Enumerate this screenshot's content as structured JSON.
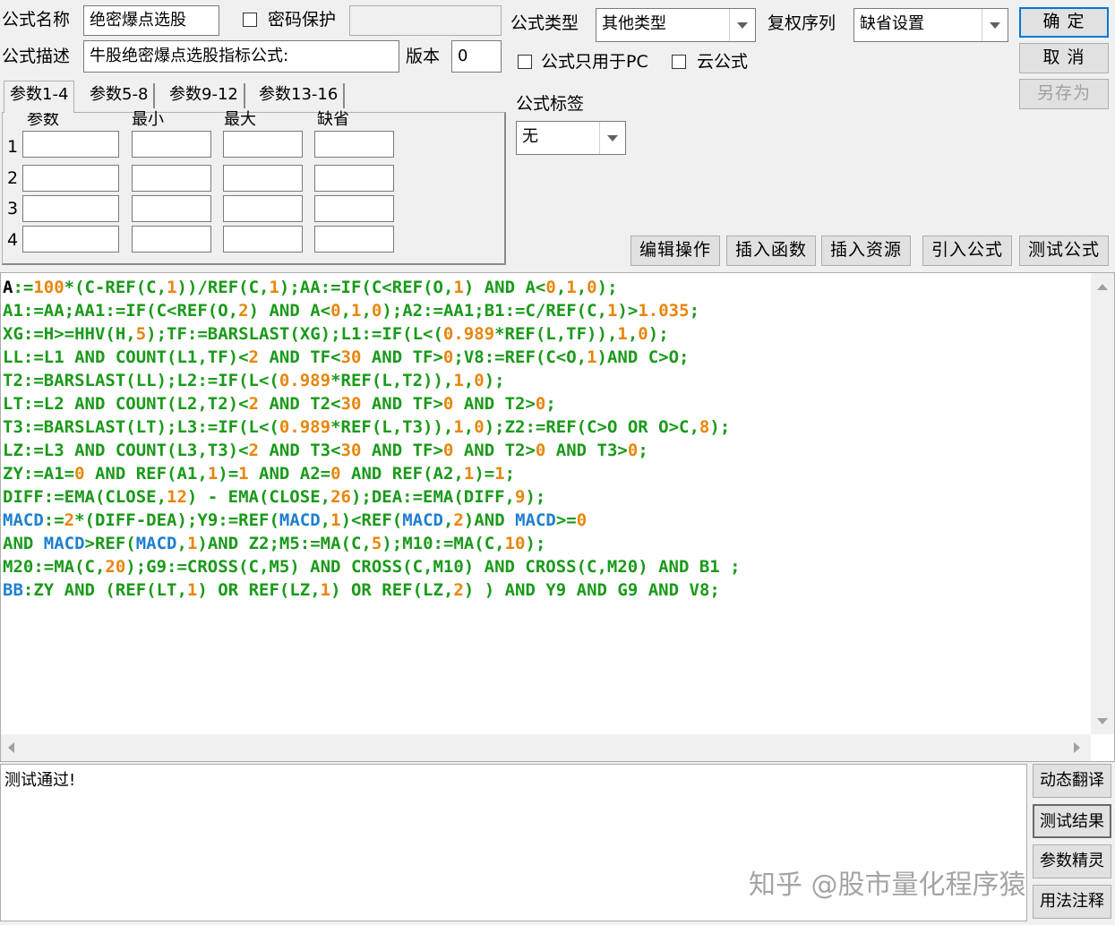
{
  "header": {
    "name_label": "公式名称",
    "name_value": "绝密爆点选股",
    "password_label": "密码保护",
    "desc_label": "公式描述",
    "desc_value": "牛股绝密爆点选股指标公式:",
    "version_label": "版本",
    "version_value": "0",
    "type_label": "公式类型",
    "type_value": "其他类型",
    "rights_label": "复权序列",
    "rights_value": "缺省设置",
    "pc_only_label": "公式只用于PC",
    "cloud_label": "云公式",
    "tag_label": "公式标签",
    "tag_value": "无"
  },
  "buttons": {
    "ok": "确 定",
    "cancel": "取 消",
    "save_as": "另存为",
    "edit_ops": "编辑操作",
    "insert_func": "插入函数",
    "insert_res": "插入资源",
    "import_formula": "引入公式",
    "test_formula": "测试公式"
  },
  "params": {
    "tabs": [
      "参数1-4",
      "参数5-8",
      "参数9-12",
      "参数13-16"
    ],
    "columns": [
      "参数",
      "最小",
      "最大",
      "缺省"
    ],
    "rows": [
      "1",
      "2",
      "3",
      "4"
    ]
  },
  "colors": {
    "keyword": "#1a9a1a",
    "number": "#e8860a",
    "text": "#000000",
    "macd": "#1e7fd0"
  },
  "code_lines": [
    [
      [
        "A:=",
        "t"
      ],
      [
        "100",
        "n"
      ],
      [
        "*(C-REF(C,",
        "k"
      ],
      [
        "1",
        "n"
      ],
      [
        "))/REF(C,",
        "k"
      ],
      [
        "1",
        "n"
      ],
      [
        ");AA:=IF(C<REF(O,",
        "k"
      ],
      [
        "1",
        "n"
      ],
      [
        ") AND A<",
        "k"
      ],
      [
        "0",
        "n"
      ],
      [
        ",",
        "k"
      ],
      [
        "1",
        "n"
      ],
      [
        ",",
        "k"
      ],
      [
        "0",
        "n"
      ],
      [
        ");",
        "k"
      ]
    ],
    [
      [
        "A1:=AA;AA1:=IF(C<REF(O,",
        "k"
      ],
      [
        "2",
        "n"
      ],
      [
        ") AND A<",
        "k"
      ],
      [
        "0",
        "n"
      ],
      [
        ",",
        "k"
      ],
      [
        "1",
        "n"
      ],
      [
        ",",
        "k"
      ],
      [
        "0",
        "n"
      ],
      [
        ");A2:=AA1;B1:=C/REF(C,",
        "k"
      ],
      [
        "1",
        "n"
      ],
      [
        ")>",
        "k"
      ],
      [
        "1.035",
        "n"
      ],
      [
        ";",
        "k"
      ]
    ],
    [
      [
        "XG:=H>=HHV(H,",
        "k"
      ],
      [
        "5",
        "n"
      ],
      [
        ");TF:=BARSLAST(XG);L1:=IF(L<(",
        "k"
      ],
      [
        "0.989",
        "n"
      ],
      [
        "*REF(L,TF)),",
        "k"
      ],
      [
        "1",
        "n"
      ],
      [
        ",",
        "k"
      ],
      [
        "0",
        "n"
      ],
      [
        ");",
        "k"
      ]
    ],
    [
      [
        "LL:=L1 AND COUNT(L1,TF)<",
        "k"
      ],
      [
        "2",
        "n"
      ],
      [
        " AND TF<",
        "k"
      ],
      [
        "30",
        "n"
      ],
      [
        " AND TF>",
        "k"
      ],
      [
        "0",
        "n"
      ],
      [
        ";V8:=REF(C<O,",
        "k"
      ],
      [
        "1",
        "n"
      ],
      [
        ")AND C>O;",
        "k"
      ]
    ],
    [
      [
        "T2:=BARSLAST(LL);L2:=IF(L<(",
        "k"
      ],
      [
        "0.989",
        "n"
      ],
      [
        "*REF(L,T2)),",
        "k"
      ],
      [
        "1",
        "n"
      ],
      [
        ",",
        "k"
      ],
      [
        "0",
        "n"
      ],
      [
        ");",
        "k"
      ]
    ],
    [
      [
        "LT:=L2 AND COUNT(L2,T2)<",
        "k"
      ],
      [
        "2",
        "n"
      ],
      [
        " AND T2<",
        "k"
      ],
      [
        "30",
        "n"
      ],
      [
        " AND TF>",
        "k"
      ],
      [
        "0",
        "n"
      ],
      [
        " AND T2>",
        "k"
      ],
      [
        "0",
        "n"
      ],
      [
        ";",
        "k"
      ]
    ],
    [
      [
        "T3:=BARSLAST(LT);L3:=IF(L<(",
        "k"
      ],
      [
        "0.989",
        "n"
      ],
      [
        "*REF(L,T3)),",
        "k"
      ],
      [
        "1",
        "n"
      ],
      [
        ",",
        "k"
      ],
      [
        "0",
        "n"
      ],
      [
        ");Z2:=REF(C>O OR O>C,",
        "k"
      ],
      [
        "8",
        "n"
      ],
      [
        ");",
        "k"
      ]
    ],
    [
      [
        "LZ:=L3 AND COUNT(L3,T3)<",
        "k"
      ],
      [
        "2",
        "n"
      ],
      [
        " AND T3<",
        "k"
      ],
      [
        "30",
        "n"
      ],
      [
        " AND TF>",
        "k"
      ],
      [
        "0",
        "n"
      ],
      [
        " AND T2>",
        "k"
      ],
      [
        "0",
        "n"
      ],
      [
        " AND T3>",
        "k"
      ],
      [
        "0",
        "n"
      ],
      [
        ";",
        "k"
      ]
    ],
    [
      [
        "ZY:=A1=",
        "k"
      ],
      [
        "0",
        "n"
      ],
      [
        " AND REF(A1,",
        "k"
      ],
      [
        "1",
        "n"
      ],
      [
        ")=",
        "k"
      ],
      [
        "1",
        "n"
      ],
      [
        " AND A2=",
        "k"
      ],
      [
        "0",
        "n"
      ],
      [
        " AND REF(A2,",
        "k"
      ],
      [
        "1",
        "n"
      ],
      [
        ")=",
        "k"
      ],
      [
        "1",
        "n"
      ],
      [
        ";",
        "k"
      ]
    ],
    [
      [
        "DIFF:=EMA(CLOSE,",
        "k"
      ],
      [
        "12",
        "n"
      ],
      [
        ") - EMA(CLOSE,",
        "k"
      ],
      [
        "26",
        "n"
      ],
      [
        ");DEA:=EMA(DIFF,",
        "k"
      ],
      [
        "9",
        "n"
      ],
      [
        ");",
        "k"
      ]
    ],
    [
      [
        "MACD",
        "m"
      ],
      [
        ":=",
        "k"
      ],
      [
        "2",
        "n"
      ],
      [
        "*(DIFF-DEA);Y9:=REF(",
        "k"
      ],
      [
        "MACD",
        "m"
      ],
      [
        ",",
        "k"
      ],
      [
        "1",
        "n"
      ],
      [
        ")<REF(",
        "k"
      ],
      [
        "MACD",
        "m"
      ],
      [
        ",",
        "k"
      ],
      [
        "2",
        "n"
      ],
      [
        ")AND ",
        "k"
      ],
      [
        "MACD",
        "m"
      ],
      [
        ">=",
        "k"
      ],
      [
        "0",
        "n"
      ]
    ],
    [
      [
        "AND ",
        "k"
      ],
      [
        "MACD",
        "m"
      ],
      [
        ">REF(",
        "k"
      ],
      [
        "MACD",
        "m"
      ],
      [
        ",",
        "k"
      ],
      [
        "1",
        "n"
      ],
      [
        ")AND Z2;M5:=MA(C,",
        "k"
      ],
      [
        "5",
        "n"
      ],
      [
        ");M10:=MA(C,",
        "k"
      ],
      [
        "10",
        "n"
      ],
      [
        ");",
        "k"
      ]
    ],
    [
      [
        "M20:=MA(C,",
        "k"
      ],
      [
        "20",
        "n"
      ],
      [
        ");G9:=CROSS(C,M5) AND CROSS(C,M10) AND CROSS(C,M20) AND B1 ;",
        "k"
      ]
    ],
    [
      [
        "BB",
        "m"
      ],
      [
        ":ZY AND (REF(LT,",
        "k"
      ],
      [
        "1",
        "n"
      ],
      [
        ") OR REF(LZ,",
        "k"
      ],
      [
        "1",
        "n"
      ],
      [
        ") OR REF(LZ,",
        "k"
      ],
      [
        "2",
        "n"
      ],
      [
        ") ) AND Y9 AND G9 AND V8;",
        "k"
      ]
    ]
  ],
  "result": {
    "text": "测试通过!"
  },
  "side_buttons": {
    "translate": "动态翻译",
    "test_result": "测试结果",
    "param_wizard": "参数精灵",
    "usage_notes": "用法注释"
  },
  "watermark": "知乎 @股市量化程序猿"
}
